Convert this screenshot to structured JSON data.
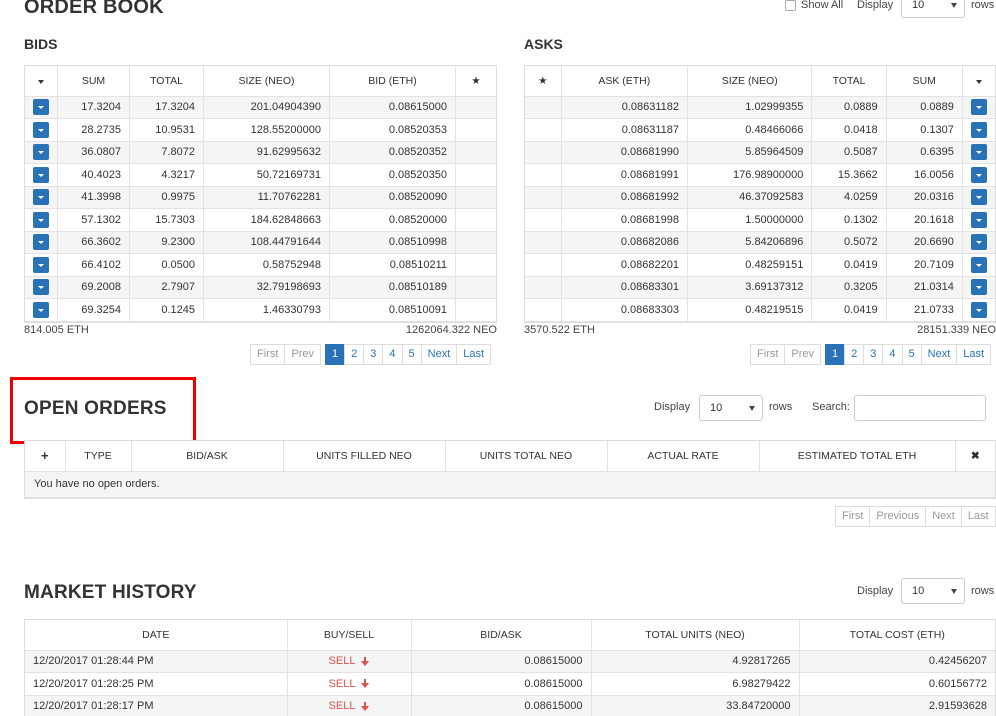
{
  "orderbook": {
    "title": "ORDER BOOK",
    "show_all_label": "Show All",
    "display_label": "Display",
    "display_value": "10",
    "rows_label": "rows",
    "bids": {
      "title": "BIDS",
      "columns": [
        "SUM",
        "TOTAL",
        "SIZE (NEO)",
        "BID (ETH)"
      ],
      "rows": [
        [
          "17.3204",
          "17.3204",
          "201.04904390",
          "0.08615000"
        ],
        [
          "28.2735",
          "10.9531",
          "128.55200000",
          "0.08520353"
        ],
        [
          "36.0807",
          "7.8072",
          "91.62995632",
          "0.08520352"
        ],
        [
          "40.4023",
          "4.3217",
          "50.72169731",
          "0.08520350"
        ],
        [
          "41.3998",
          "0.9975",
          "11.70762281",
          "0.08520090"
        ],
        [
          "57.1302",
          "15.7303",
          "184.62848663",
          "0.08520000"
        ],
        [
          "66.3602",
          "9.2300",
          "108.44791644",
          "0.08510998"
        ],
        [
          "66.4102",
          "0.0500",
          "0.58752948",
          "0.08510211"
        ],
        [
          "69.2008",
          "2.7907",
          "32.79198693",
          "0.08510189"
        ],
        [
          "69.3254",
          "0.1245",
          "1.46330793",
          "0.08510091"
        ]
      ],
      "total_eth": "814.005 ETH",
      "total_neo": "1262064.322 NEO"
    },
    "asks": {
      "title": "ASKS",
      "columns": [
        "ASK (ETH)",
        "SIZE (NEO)",
        "TOTAL",
        "SUM"
      ],
      "rows": [
        [
          "0.08631182",
          "1.02999355",
          "0.0889",
          "0.0889"
        ],
        [
          "0.08631187",
          "0.48466066",
          "0.0418",
          "0.1307"
        ],
        [
          "0.08681990",
          "5.85964509",
          "0.5087",
          "0.6395"
        ],
        [
          "0.08681991",
          "176.98900000",
          "15.3662",
          "16.0056"
        ],
        [
          "0.08681992",
          "46.37092583",
          "4.0259",
          "20.0316"
        ],
        [
          "0.08681998",
          "1.50000000",
          "0.1302",
          "20.1618"
        ],
        [
          "0.08682086",
          "5.84206896",
          "0.5072",
          "20.6690"
        ],
        [
          "0.08682201",
          "0.48259151",
          "0.0419",
          "20.7109"
        ],
        [
          "0.08683301",
          "3.69137312",
          "0.3205",
          "21.0314"
        ],
        [
          "0.08683303",
          "0.48219515",
          "0.0419",
          "21.0733"
        ]
      ],
      "total_eth": "3570.522 ETH",
      "total_neo": "28151.339 NEO"
    },
    "pager": {
      "first": "First",
      "prev": "Prev",
      "pages": [
        "1",
        "2",
        "3",
        "4",
        "5"
      ],
      "next": "Next",
      "last": "Last"
    }
  },
  "open_orders": {
    "title": "OPEN ORDERS",
    "display_label": "Display",
    "display_value": "10",
    "rows_label": "rows",
    "search_label": "Search:",
    "search_value": "",
    "columns": [
      "TYPE",
      "BID/ASK",
      "UNITS FILLED NEO",
      "UNITS TOTAL NEO",
      "ACTUAL RATE",
      "ESTIMATED TOTAL ETH"
    ],
    "empty_message": "You have no open orders.",
    "pager": {
      "first": "First",
      "previous": "Previous",
      "next": "Next",
      "last": "Last"
    }
  },
  "market_history": {
    "title": "MARKET HISTORY",
    "display_label": "Display",
    "display_value": "10",
    "rows_label": "rows",
    "columns": [
      "DATE",
      "BUY/SELL",
      "BID/ASK",
      "TOTAL UNITS (NEO)",
      "TOTAL COST (ETH)"
    ],
    "rows": [
      [
        "12/20/2017 01:28:44 PM",
        "SELL",
        "0.08615000",
        "4.92817265",
        "0.42456207"
      ],
      [
        "12/20/2017 01:28:25 PM",
        "SELL",
        "0.08615000",
        "6.98279422",
        "0.60156772"
      ],
      [
        "12/20/2017 01:28:17 PM",
        "SELL",
        "0.08615000",
        "33.84720000",
        "2.91593628"
      ]
    ]
  },
  "colors": {
    "accent": "#2a72b8",
    "sell": "#d9534f",
    "highlight": "#e00000"
  }
}
